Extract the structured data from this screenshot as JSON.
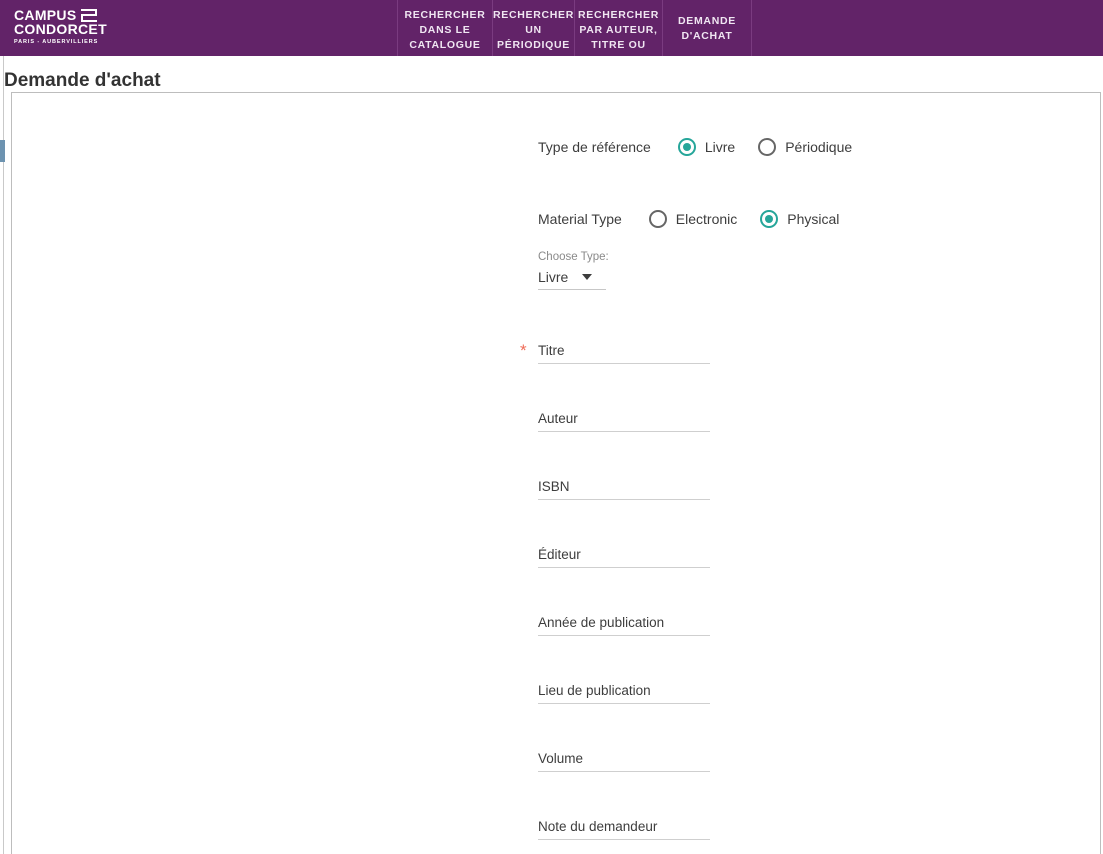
{
  "header": {
    "background_color": "#622368",
    "logo": {
      "line1": "CAMPUS",
      "line2": "CONDORCET",
      "subtitle": "PARIS - AUBERVILLIERS",
      "mark_name": "condorcet-monogram"
    },
    "nav": [
      {
        "label": "RECHERCHER DANS LE CATALOGUE",
        "name": "nav-rechercher-catalogue"
      },
      {
        "label": "RECHERCHER UN PÉRIODIQUE",
        "name": "nav-rechercher-periodique"
      },
      {
        "label": "RECHERCHER PAR AUTEUR, TITRE OU SUJET",
        "name": "nav-rechercher-auteur-titre-sujet"
      },
      {
        "label": "DEMANDE D'ACHAT",
        "name": "nav-demande-achat"
      }
    ]
  },
  "page": {
    "title": "Demande d'achat"
  },
  "form": {
    "reference_type": {
      "label": "Type de référence",
      "options": [
        {
          "label": "Livre",
          "selected": true
        },
        {
          "label": "Périodique",
          "selected": false
        }
      ]
    },
    "material_type": {
      "label": "Material Type",
      "options": [
        {
          "label": "Electronic",
          "selected": false
        },
        {
          "label": "Physical",
          "selected": true
        }
      ]
    },
    "choose_type": {
      "caption": "Choose Type:",
      "value": "Livre",
      "options": [
        "Livre"
      ]
    },
    "fields": [
      {
        "label": "Titre",
        "value": "",
        "required": true
      },
      {
        "label": "Auteur",
        "value": "",
        "required": false
      },
      {
        "label": "ISBN",
        "value": "",
        "required": false
      },
      {
        "label": "Éditeur",
        "value": "",
        "required": false
      },
      {
        "label": "Année de publication",
        "value": "",
        "required": false
      },
      {
        "label": "Lieu de publication",
        "value": "",
        "required": false
      },
      {
        "label": "Volume",
        "value": "",
        "required": false
      },
      {
        "label": "Note du demandeur",
        "value": "",
        "required": false
      }
    ],
    "required_marker": "*"
  },
  "colors": {
    "brand_purple": "#622368",
    "radio_selected": "#26a69a",
    "required_star": "#ef6b57",
    "text": "#3d3d3d",
    "left_marker": "#6d93b0"
  }
}
